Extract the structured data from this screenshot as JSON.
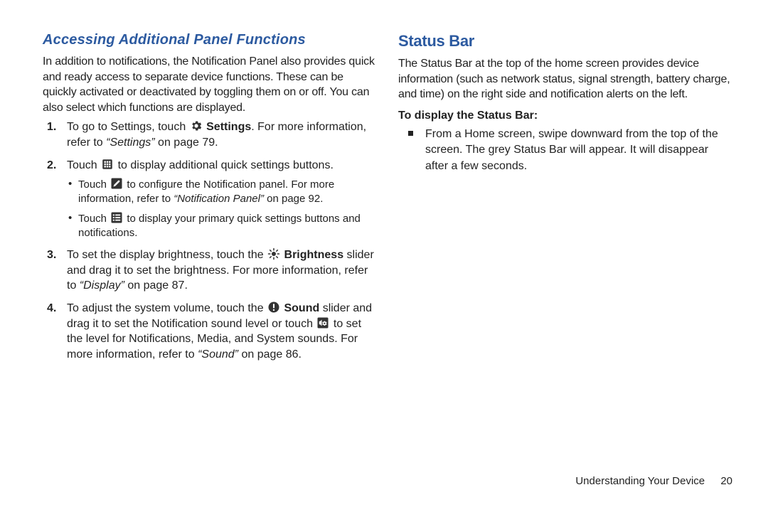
{
  "left": {
    "heading": "Accessing Additional Panel Functions",
    "intro": "In addition to notifications, the Notification Panel also provides quick and ready access to separate device functions. These can be quickly activated or deactivated by toggling them on or off. You can also select which functions are displayed.",
    "items": {
      "i1": {
        "num": "1.",
        "a": "To go to Settings, touch ",
        "settings": "Settings",
        "b": ". For more information, refer to ",
        "ref": "“Settings”",
        "c": " on page 79."
      },
      "i2": {
        "num": "2.",
        "a": "Touch ",
        "b": " to display additional quick settings buttons.",
        "s1a": "Touch ",
        "s1b": " to configure the Notification panel. For more information, refer to ",
        "s1ref": "“Notification Panel”",
        "s1c": " on page 92.",
        "s2a": "Touch ",
        "s2b": " to display your primary quick settings buttons and notifications."
      },
      "i3": {
        "num": "3.",
        "a": "To set the display brightness, touch the ",
        "bright": "Brightness",
        "b": " slider and drag it to set the brightness. For more information, refer to ",
        "ref": "“Display”",
        "c": " on page 87."
      },
      "i4": {
        "num": "4.",
        "a": "To adjust the system volume, touch the ",
        "sound": "Sound",
        "b": " slider and drag it to set the Notification sound level or touch ",
        "c": " to set the level for Notifications, Media, and System sounds. For more information, refer to ",
        "ref": "“Sound”",
        "d": " on page 86."
      }
    }
  },
  "right": {
    "heading": "Status Bar",
    "intro": "The Status Bar at the top of the home screen provides device information (such as network status, signal strength, battery charge, and time) on the right side and notification alerts on the left.",
    "subhead": "To display the Status Bar:",
    "bullet": "From a Home screen, swipe downward from the top of the screen. The grey Status Bar will appear. It will disappear after a few seconds."
  },
  "footer": {
    "label": "Understanding Your Device",
    "page": "20"
  }
}
